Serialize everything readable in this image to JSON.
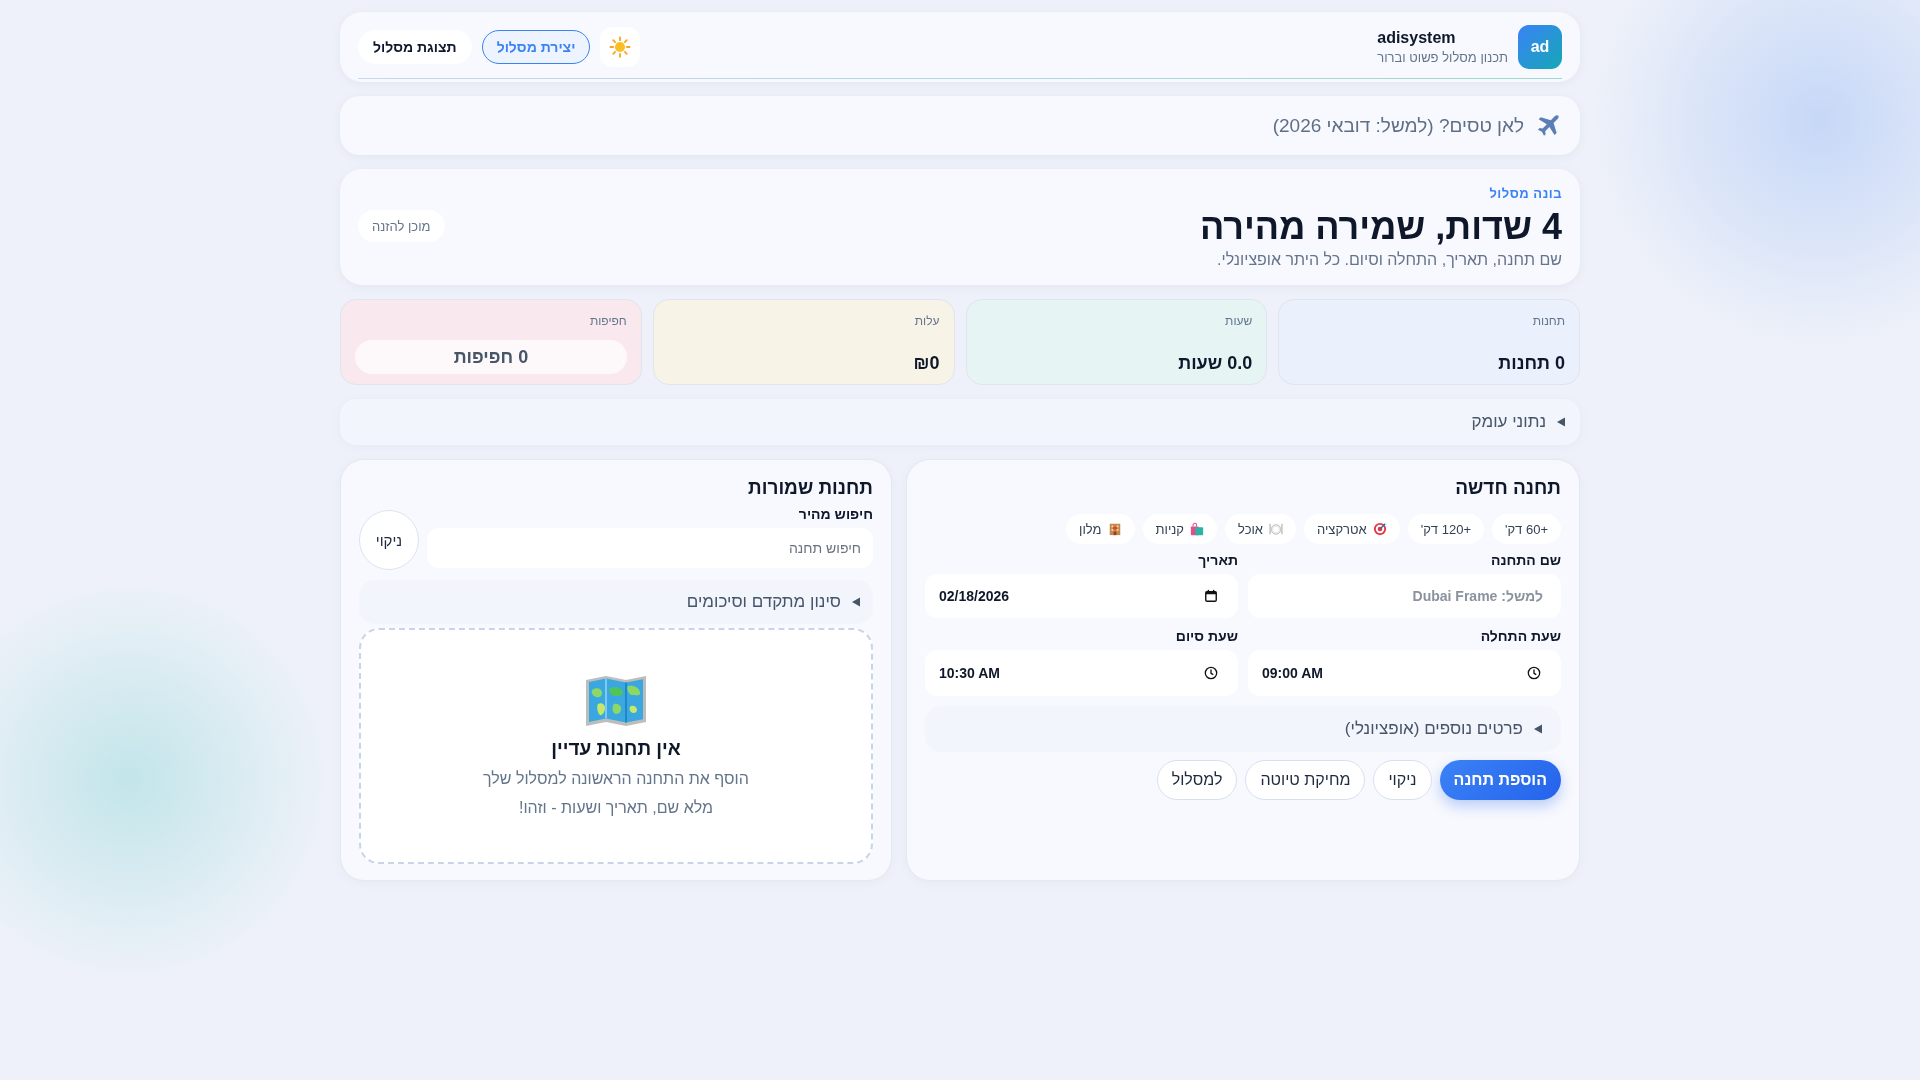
{
  "header": {
    "logo": "ad",
    "app_name": "adisystem",
    "tagline": "תכנון מסלול פשוט וברור",
    "tabs": [
      {
        "label": "יצירת מסלול",
        "selected": true
      },
      {
        "label": "תצוגת מסלול",
        "selected": false
      }
    ]
  },
  "trip": {
    "placeholder": "לאן טסים? (למשל: דובאי 2026)"
  },
  "hero": {
    "eyebrow": "בונה מסלול",
    "title": "4 שדות, שמירה מהירה",
    "subtitle": "שם תחנה, תאריך, התחלה וסיום. כל היתר אופציונלי.",
    "badge": "מוכן להזנה"
  },
  "stats": [
    {
      "label": "תחנות",
      "value": "0 תחנות",
      "color": "#eaf0fc",
      "kind": "plain"
    },
    {
      "label": "שעות",
      "value": "0.0 שעות",
      "color": "#e6f5f4",
      "kind": "plain"
    },
    {
      "label": "עלות",
      "value": "₪0",
      "color": "#f8f3e7",
      "kind": "plain"
    },
    {
      "label": "חפיפות",
      "value": "0 חפיפות",
      "color": "#f9e9ef",
      "kind": "pill"
    }
  ],
  "depth": {
    "label": "נתוני עומק",
    "expanded": false
  },
  "new_station": {
    "title": "תחנה חדשה",
    "chips": [
      {
        "label": "+60 דק'",
        "kind": "duration"
      },
      {
        "label": "+120 דק'",
        "kind": "duration"
      },
      {
        "label": "אטרקציה",
        "kind": "attraction"
      },
      {
        "label": "אוכל",
        "kind": "food"
      },
      {
        "label": "קניות",
        "kind": "shopping"
      },
      {
        "label": "מלון",
        "kind": "hotel"
      }
    ],
    "fields": [
      {
        "label": "שם התחנה",
        "placeholder": "למשל: Dubai Frame",
        "kind": "text"
      },
      {
        "label": "תאריך",
        "value": "02/18/2026",
        "kind": "date"
      },
      {
        "label": "שעת התחלה",
        "value": "09:00 AM",
        "kind": "time"
      },
      {
        "label": "שעת סיום",
        "value": "10:30 AM",
        "kind": "time"
      }
    ],
    "details": {
      "label": "פרטים נוספים (אופציונלי)",
      "expanded": false
    },
    "buttons": [
      {
        "label": "הוספת תחנה",
        "kind": "primary"
      },
      {
        "label": "ניקוי",
        "kind": "secondary"
      },
      {
        "label": "מחיקת טיוטה",
        "kind": "secondary"
      },
      {
        "label": "למסלול",
        "kind": "secondary"
      }
    ]
  },
  "saved": {
    "title": "תחנות שמורות",
    "search_label": "חיפוש מהיר",
    "search_placeholder": "חיפוש תחנה",
    "clear_button": "ניקוי",
    "filter": {
      "label": "סינון מתקדם וסיכומים",
      "expanded": false
    },
    "empty": {
      "title": "אין תחנות עדיין",
      "lines": [
        "הוסף את התחנה הראשונה למסלול שלך",
        "מלא שם, תאריך ושעות - וזהו!"
      ]
    }
  }
}
